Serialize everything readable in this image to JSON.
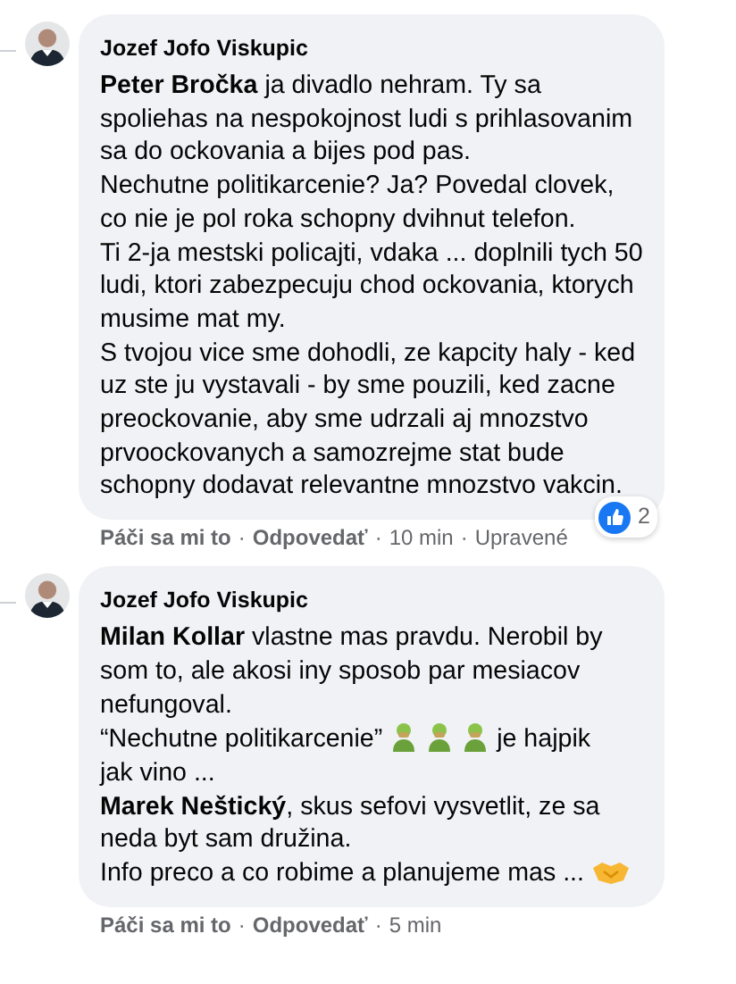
{
  "comments": [
    {
      "author": "Jozef Jofo Viskupic",
      "paragraphs": [
        {
          "kind": "text",
          "text": "**Peter Bročka** ja divadlo nehram. Ty sa spoliehas na nespokojnost ludi s prihlasovanim sa do ockovania a bijes pod pas."
        },
        {
          "kind": "text",
          "text": "Nechutne politikarcenie? Ja? Povedal clovek, co nie je pol roka schopny dvihnut telefon."
        },
        {
          "kind": "text",
          "text": "Ti 2-ja mestski policajti, vdaka ... doplnili tych 50 ludi, ktori zabezpecuju chod ockovania, ktorych musime mat my."
        },
        {
          "kind": "text",
          "text": "S tvojou vice sme dohodli, ze kapcity haly - ked uz ste ju vystavali - by sme pouzili, ked zacne preockovanie, aby sme udrzali aj mnozstvo prvoockovanych a samozrejme stat bude schopny dodavat relevantne mnozstvo vakcin."
        }
      ],
      "reactions": {
        "count": "2"
      },
      "actions": [
        {
          "kind": "link",
          "text": "Páči sa mi to"
        },
        {
          "kind": "link",
          "text": "Odpovedať",
          "sep": "·"
        },
        {
          "kind": "meta",
          "text": "10 min",
          "sep": "·"
        },
        {
          "kind": "meta",
          "text": "Upravené",
          "sep": "·"
        }
      ]
    },
    {
      "author": "Jozef Jofo Viskupic",
      "paragraphs": [
        {
          "kind": "text",
          "text": "**Milan Kollar** vlastne mas pravdu. Nerobil by som to, ale akosi iny sposob par mesiacov nefungoval."
        },
        {
          "kind": "figures_between",
          "before": "“Nechutne politikarcenie”",
          "after": "je hajpik"
        },
        {
          "kind": "text",
          "text": "jak vino ..."
        },
        {
          "kind": "text",
          "text": "**Marek Neštický**, skus sefovi vysvetlit, ze sa neda byt sam družina."
        },
        {
          "kind": "handshake_after",
          "before": "Info preco a co robime a planujeme mas ..."
        }
      ],
      "actions": [
        {
          "kind": "link",
          "text": "Páči sa mi to"
        },
        {
          "kind": "link",
          "text": "Odpovedať",
          "sep": "·"
        },
        {
          "kind": "meta",
          "text": "5 min",
          "sep": "·"
        }
      ]
    }
  ]
}
